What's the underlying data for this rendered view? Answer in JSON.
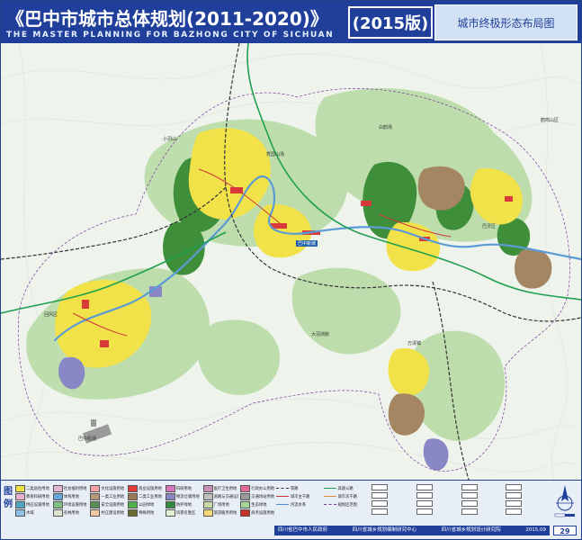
{
  "header": {
    "title_cn": "《巴中市城市总体规划(2011-2020)》",
    "title_en": "THE MASTER PLANNING FOR BAZHONG CITY OF SICHUAN",
    "edition": "(2015版)",
    "panel_title": "城市终极形态布局图"
  },
  "map": {
    "place_labels": [
      "巴中新城",
      "巴中机场",
      "小羽山",
      "大羽测鹅",
      "回风区",
      "秀国山场",
      "巴灵区",
      "万清镇",
      "鹤鸣山区",
      "白鹤场"
    ]
  },
  "legend": {
    "heading": "图例",
    "land_use_items": [
      {
        "label": "二类居住用地",
        "color": "#f2e24a"
      },
      {
        "label": "社会福利用地",
        "color": "#e2b7d6"
      },
      {
        "label": "文化设施用地",
        "color": "#f3a3a6"
      },
      {
        "label": "商业设施用地",
        "color": "#e53c3c"
      },
      {
        "label": "科研用地",
        "color": "#d676bf"
      },
      {
        "label": "医疗卫生用地",
        "color": "#c88fb8"
      },
      {
        "label": "行政办公用地",
        "color": "#e46a97"
      },
      {
        "label": "教育科研用地",
        "color": "#e9b0d2"
      },
      {
        "label": "体育用地",
        "color": "#66a6d9"
      },
      {
        "label": "一类工业用地",
        "color": "#b5977b"
      },
      {
        "label": "二类工业用地",
        "color": "#9c7a55"
      },
      {
        "label": "物流仓储用地",
        "color": "#8a87c7"
      },
      {
        "label": "道路与交通设施用地",
        "color": "#bfbfbf"
      },
      {
        "label": "交通场站用地",
        "color": "#9a9a9a"
      },
      {
        "label": "供应设施用地",
        "color": "#4fa7c1"
      },
      {
        "label": "环境设施用地",
        "color": "#7fbf7f"
      },
      {
        "label": "安全设施用地",
        "color": "#5a8f5a"
      },
      {
        "label": "公园绿地",
        "color": "#4fb24f"
      },
      {
        "label": "防护绿地",
        "color": "#2f8a3f"
      },
      {
        "label": "广场用地",
        "color": "#c7d9a6"
      },
      {
        "label": "生态绿地",
        "color": "#a5d49a"
      },
      {
        "label": "水域",
        "color": "#8fc3e8"
      },
      {
        "label": "农林用地",
        "color": "#d9e7cf"
      },
      {
        "label": "村庄建设用地",
        "color": "#f0c9a0"
      },
      {
        "label": "特殊用地",
        "color": "#6b6b2f"
      },
      {
        "label": "风景名胜区",
        "color": "#dff0d0"
      },
      {
        "label": "旅游服务用地",
        "color": "#f6d87a"
      },
      {
        "label": "商务设施用地",
        "color": "#c9302c"
      }
    ],
    "line_items": [
      {
        "label": "铁路",
        "color": "#333333",
        "style": "dashed"
      },
      {
        "label": "高速公路",
        "color": "#1f9f4f",
        "style": "solid"
      },
      {
        "label": "城市主干路",
        "color": "#d0353a",
        "style": "solid"
      },
      {
        "label": "城市次干路",
        "color": "#e28a3a",
        "style": "solid"
      },
      {
        "label": "河流水系",
        "color": "#4f8fd0",
        "style": "solid"
      },
      {
        "label": "规划区范围",
        "color": "#7a3a9a",
        "style": "dashed"
      }
    ],
    "footer": {
      "org1": "四川省巴中市人民政府",
      "org2": "四川省城乡规划编制研究中心",
      "org3": "四川省城乡规划设计研究院",
      "date": "2015.09"
    },
    "page_number": "29"
  }
}
